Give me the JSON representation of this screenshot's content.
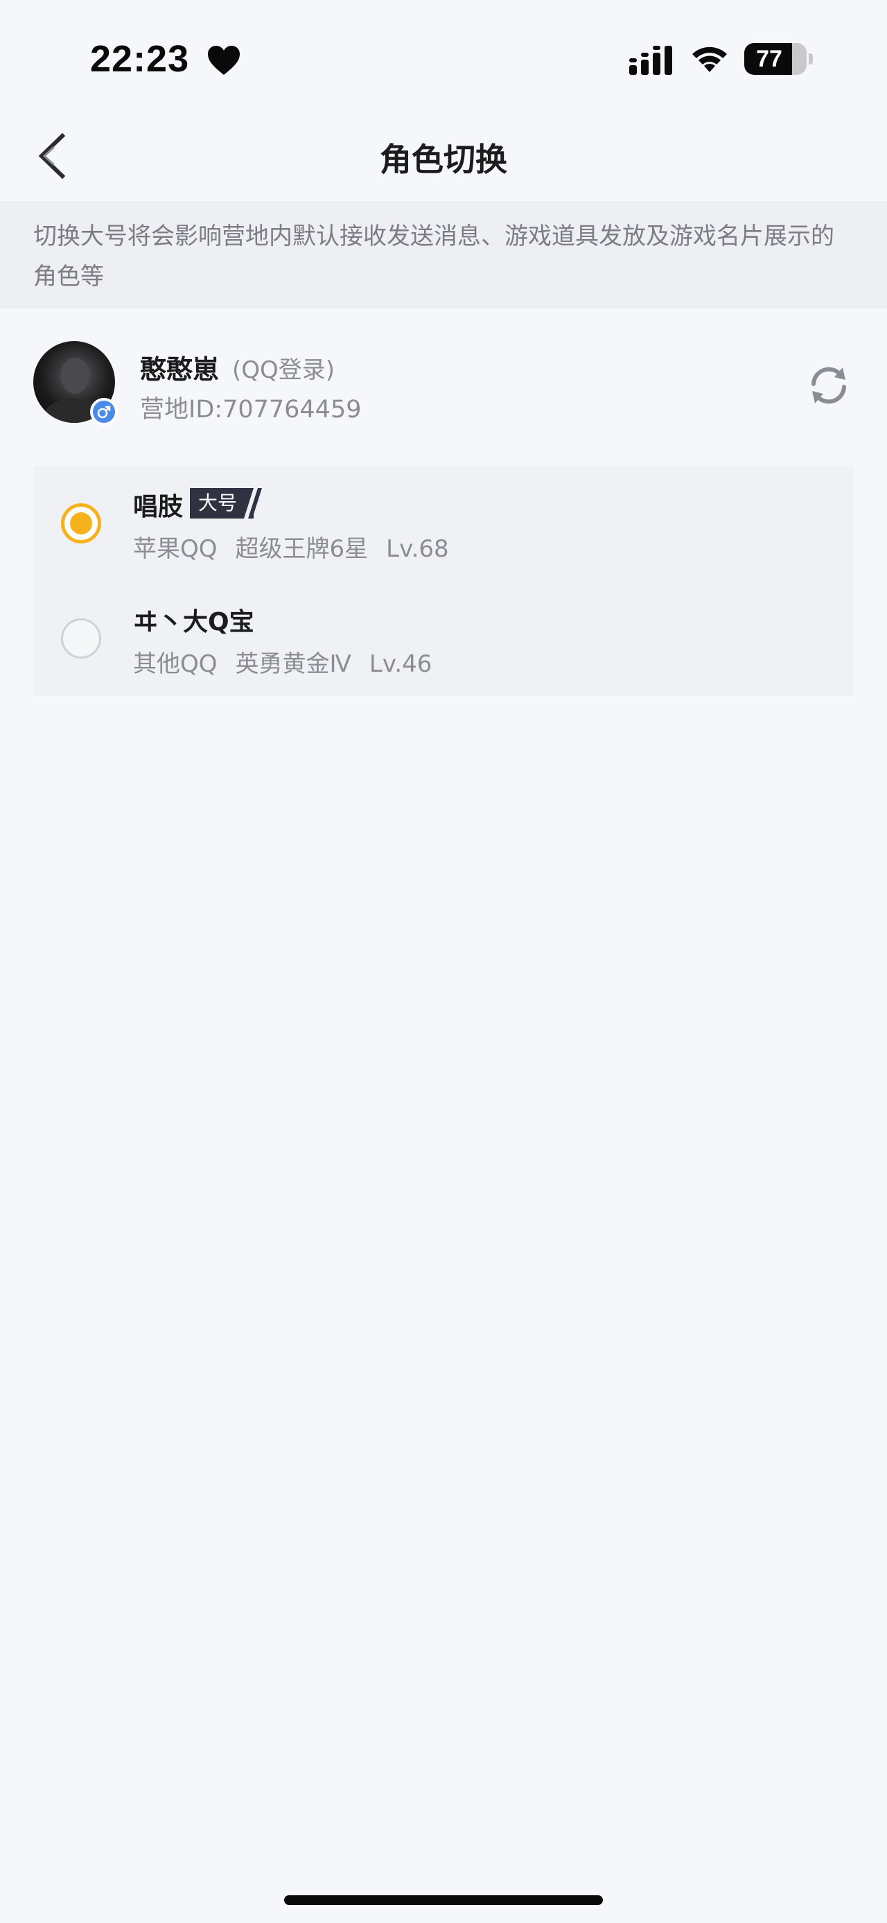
{
  "status_bar": {
    "time": "22:23",
    "battery_level": "77",
    "battery_fraction": 0.77
  },
  "nav": {
    "title": "角色切换"
  },
  "notice": {
    "text": "切换大号将会影响营地内默认接收发送消息、游戏道具发放及游戏名片展示的角色等"
  },
  "account": {
    "name": "憨憨崽",
    "login_type": "(QQ登录)",
    "camp_id": "营地ID:707764459"
  },
  "roles": [
    {
      "name": "唱肢",
      "tag": "大号",
      "platform": "苹果QQ",
      "rank": "超级王牌6星",
      "level": "Lv.68",
      "selected": true
    },
    {
      "name": "ヰ丶大Q宝",
      "platform": "其他QQ",
      "rank": "英勇黄金Ⅳ",
      "level": "Lv.46",
      "selected": false
    }
  ],
  "colors": {
    "accent": "#f5b21d",
    "gender_badge": "#4a8bea",
    "tag_bg": "#2f3341",
    "notice_bg": "#eeeff2",
    "page_bg": "#f6f7fa"
  },
  "icons": [
    "heart-icon",
    "cellular-signal-icon",
    "wifi-icon",
    "battery-icon",
    "back-chevron-icon",
    "male-icon",
    "refresh-icon"
  ]
}
